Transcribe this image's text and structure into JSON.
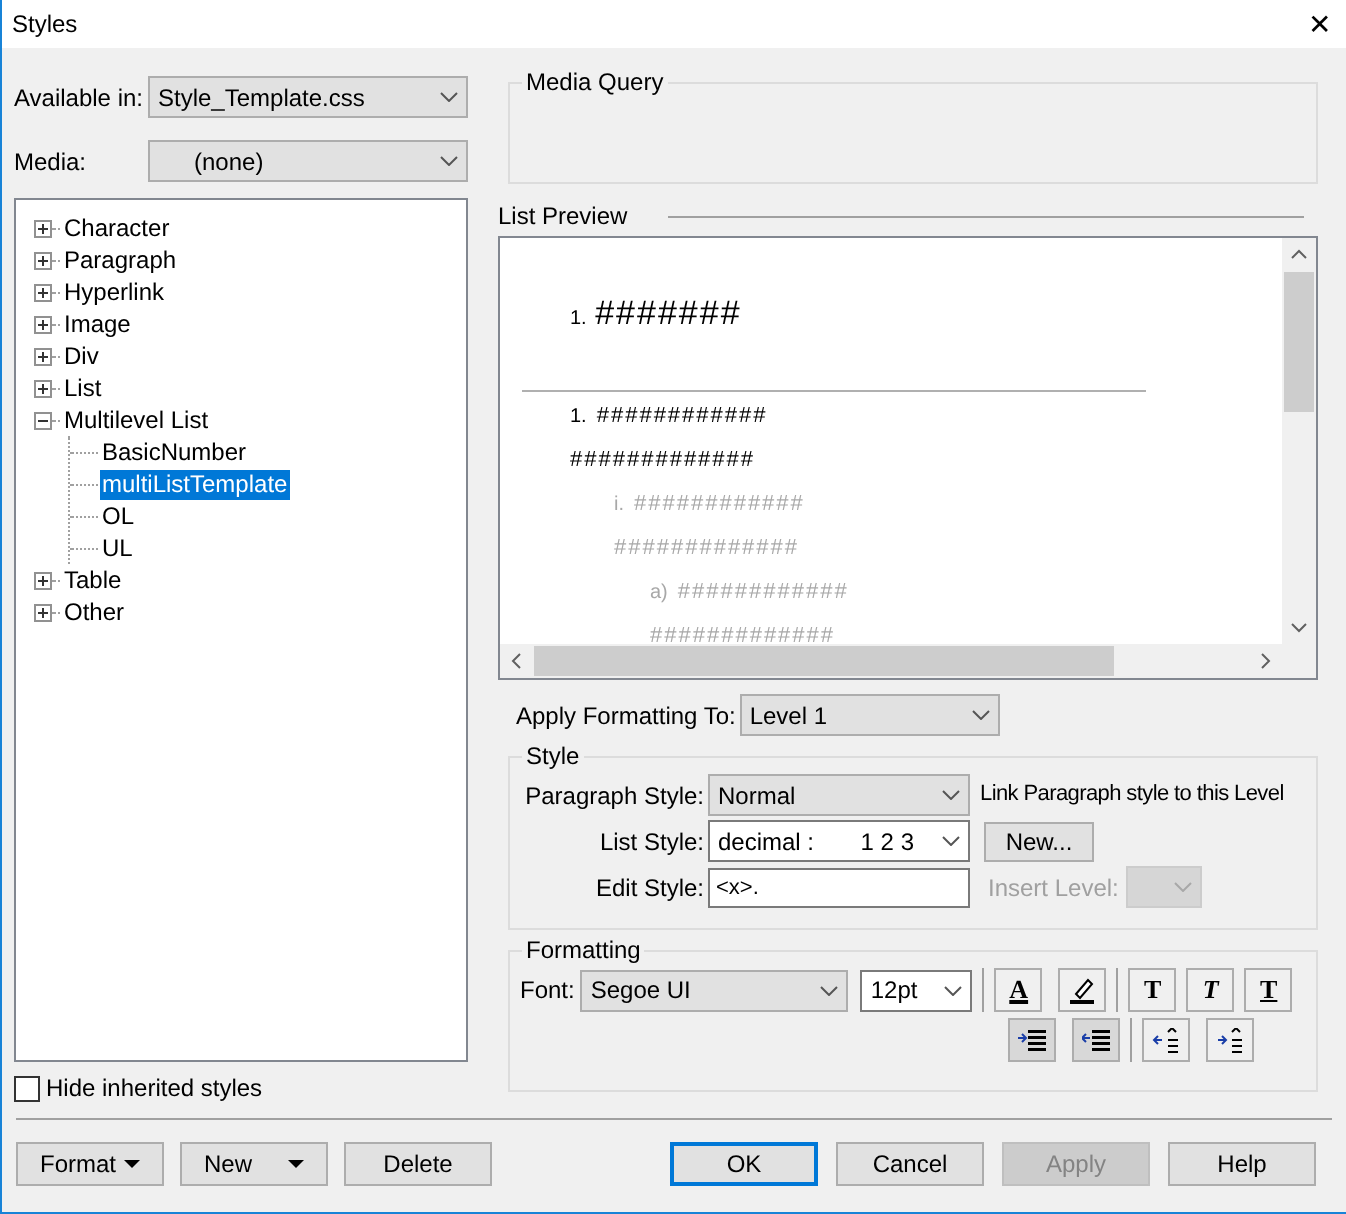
{
  "window": {
    "title": "Styles",
    "close": "✕"
  },
  "available_in": {
    "label": "Available in:",
    "value": "Style_Template.css"
  },
  "media": {
    "label": "Media:",
    "value": "(none)"
  },
  "tree": [
    {
      "label": "Character",
      "expanded": false,
      "selected": false
    },
    {
      "label": "Paragraph",
      "expanded": false,
      "selected": false
    },
    {
      "label": "Hyperlink",
      "expanded": false,
      "selected": false
    },
    {
      "label": "Image",
      "expanded": false,
      "selected": false
    },
    {
      "label": "Div",
      "expanded": false,
      "selected": false
    },
    {
      "label": "List",
      "expanded": false,
      "selected": false
    },
    {
      "label": "Multilevel List",
      "expanded": true,
      "selected": false,
      "children": [
        {
          "label": "BasicNumber",
          "selected": false
        },
        {
          "label": "multiListTemplate",
          "selected": true
        },
        {
          "label": "OL",
          "selected": false
        },
        {
          "label": "UL",
          "selected": false
        }
      ]
    },
    {
      "label": "Table",
      "expanded": false,
      "selected": false
    },
    {
      "label": "Other",
      "expanded": false,
      "selected": false
    }
  ],
  "hide_inherited": {
    "label": "Hide inherited styles",
    "checked": false
  },
  "media_query": {
    "title": "Media Query"
  },
  "list_preview": {
    "title": "List Preview",
    "heading": {
      "marker": "1.",
      "text": "#######"
    },
    "items": [
      {
        "marker": "1.",
        "text": "############",
        "continuation": "#############",
        "children": [
          {
            "marker": "i.",
            "text": "############",
            "continuation": "#############",
            "children": [
              {
                "marker": "a)",
                "text": "############",
                "continuation": "#############"
              }
            ]
          }
        ]
      }
    ]
  },
  "apply_formatting": {
    "label": "Apply Formatting To:",
    "value": "Level 1"
  },
  "style": {
    "title": "Style",
    "paragraph_style": {
      "label": "Paragraph Style:",
      "value": "Normal",
      "note": "Link Paragraph style to this Level"
    },
    "list_style": {
      "label": "List Style:",
      "value": "decimal :",
      "sample": "1 2 3",
      "button": "New..."
    },
    "edit_style": {
      "label": "Edit Style:",
      "value": "<x>.",
      "insert_label": "Insert Level:",
      "insert_disabled": true
    }
  },
  "formatting": {
    "title": "Formatting",
    "font_label": "Font:",
    "font": "Segoe UI",
    "size": "12pt",
    "tools": [
      {
        "kind": "font-color",
        "glyph": "A"
      },
      {
        "kind": "highlight"
      },
      {
        "kind": "bold",
        "glyph": "T"
      },
      {
        "kind": "italic",
        "glyph": "T"
      },
      {
        "kind": "underline",
        "glyph": "T"
      }
    ],
    "indent_tools": [
      {
        "kind": "increase-indent"
      },
      {
        "kind": "decrease-indent"
      },
      {
        "kind": "move-left"
      },
      {
        "kind": "move-right"
      }
    ]
  },
  "buttons_left": [
    {
      "label": "Format",
      "menu": true
    },
    {
      "label": "New",
      "menu": true
    },
    {
      "label": "Delete",
      "menu": false
    }
  ],
  "buttons_right": [
    {
      "label": "OK",
      "default": true,
      "disabled": false
    },
    {
      "label": "Cancel",
      "default": false,
      "disabled": false
    },
    {
      "label": "Apply",
      "default": false,
      "disabled": true
    },
    {
      "label": "Help",
      "default": false,
      "disabled": false
    }
  ]
}
